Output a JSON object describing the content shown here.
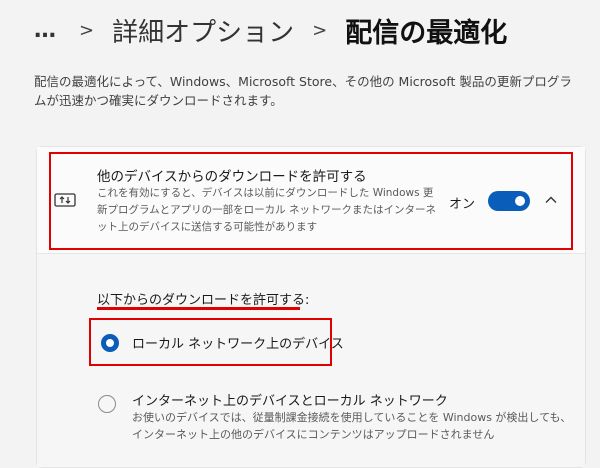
{
  "breadcrumb": {
    "more": "…",
    "separator": ">",
    "parent": "詳細オプション",
    "current": "配信の最適化"
  },
  "description": "配信の最適化によって、Windows、Microsoft Store、その他の Microsoft 製品の更新プログラムが迅速かつ確実にダウンロードされます。",
  "setting": {
    "icon": "delivery-optimization-icon",
    "title": "他のデバイスからのダウンロードを許可する",
    "description": "これを有効にすると、デバイスは以前にダウンロードした Windows 更新プログラムとアプリの一部をローカル ネットワークまたはインターネット上のデバイスに送信する可能性があります",
    "toggle_label": "オン",
    "toggle_on": true,
    "expand_icon": "chevron-up-icon"
  },
  "download_from": {
    "label": "以下からのダウンロードを許可する:",
    "options": [
      {
        "label": "ローカル ネットワーク上のデバイス",
        "selected": true
      },
      {
        "label": "インターネット上のデバイスとローカル ネットワーク",
        "description": "お使いのデバイスでは、従量制課金接続を使用していることを Windows が検出しても、インターネット上の他のデバイスにコンテンツはアップロードされません",
        "selected": false
      }
    ]
  },
  "colors": {
    "accent": "#0a5db8",
    "highlight": "#e00000",
    "background": "#f3f3f3"
  }
}
